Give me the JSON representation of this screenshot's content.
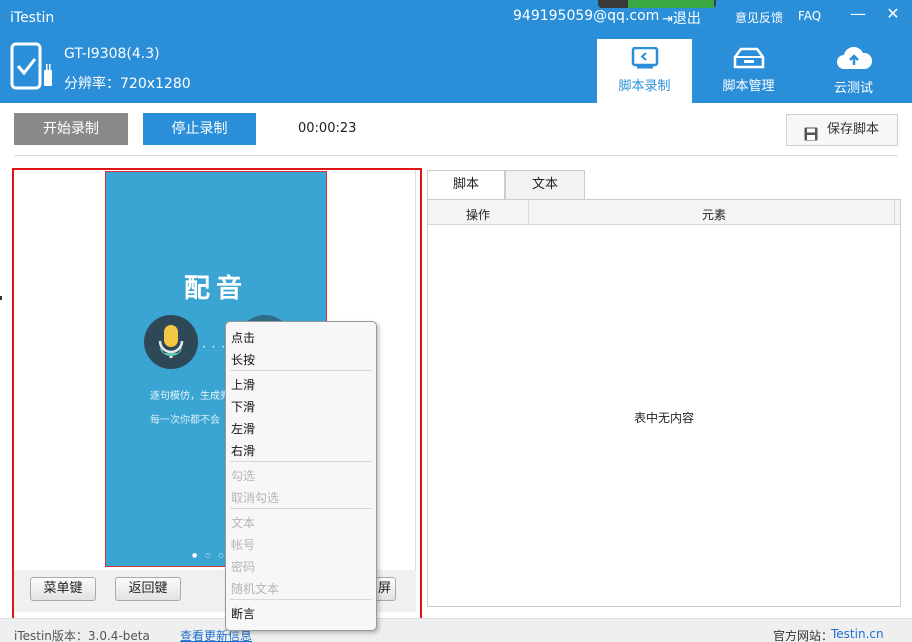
{
  "app": {
    "title": "iTestin"
  },
  "header": {
    "email": "949195059@qq.com",
    "logout": "退出",
    "feedback": "意见反馈",
    "faq": "FAQ",
    "minimize": "—",
    "close": "✕",
    "device": {
      "model": "GT-I9308(4.3)",
      "resolution": "分辨率：720x1280"
    },
    "tabs": [
      {
        "label": "脚本录制",
        "icon": "script-record-icon",
        "active": true
      },
      {
        "label": "脚本管理",
        "icon": "script-manage-icon",
        "active": false
      },
      {
        "label": "云测试",
        "icon": "cloud-icon",
        "active": false
      }
    ],
    "colors": {
      "primary": "#2a8fd8"
    }
  },
  "toolbar": {
    "start_label": "开始录制",
    "stop_label": "停止录制",
    "timer": "00:00:23",
    "save_label": "保存脚本"
  },
  "phone": {
    "title": "配音",
    "dots": "· · · · · ·",
    "text1": "逐句模仿，生成秀",
    "text2": "每一次你都不会",
    "page_dots": "● ○ ○ ○"
  },
  "device_buttons": {
    "menu": "菜单键",
    "back": "返回键",
    "screen": "屏"
  },
  "context_menu": {
    "items": [
      {
        "label": "点击",
        "disabled": false
      },
      {
        "label": "长按",
        "disabled": false
      },
      {
        "label": "上滑",
        "disabled": false
      },
      {
        "label": "下滑",
        "disabled": false
      },
      {
        "label": "左滑",
        "disabled": false
      },
      {
        "label": "右滑",
        "disabled": false
      },
      {
        "label": "勾选",
        "disabled": true
      },
      {
        "label": "取消勾选",
        "disabled": true
      },
      {
        "label": "文本",
        "disabled": true
      },
      {
        "label": "帐号",
        "disabled": true
      },
      {
        "label": "密码",
        "disabled": true
      },
      {
        "label": "随机文本",
        "disabled": true
      },
      {
        "label": "断言",
        "disabled": false
      }
    ]
  },
  "script_panel": {
    "tabs": [
      "脚本",
      "文本"
    ],
    "columns": [
      "操作",
      "元素"
    ],
    "empty_message": "表中无内容"
  },
  "status_bar": {
    "version": "iTestin版本：3.0.4-beta",
    "update_link": "查看更新信息",
    "site_label": "官方网站：",
    "site_link": "Testin.cn"
  }
}
